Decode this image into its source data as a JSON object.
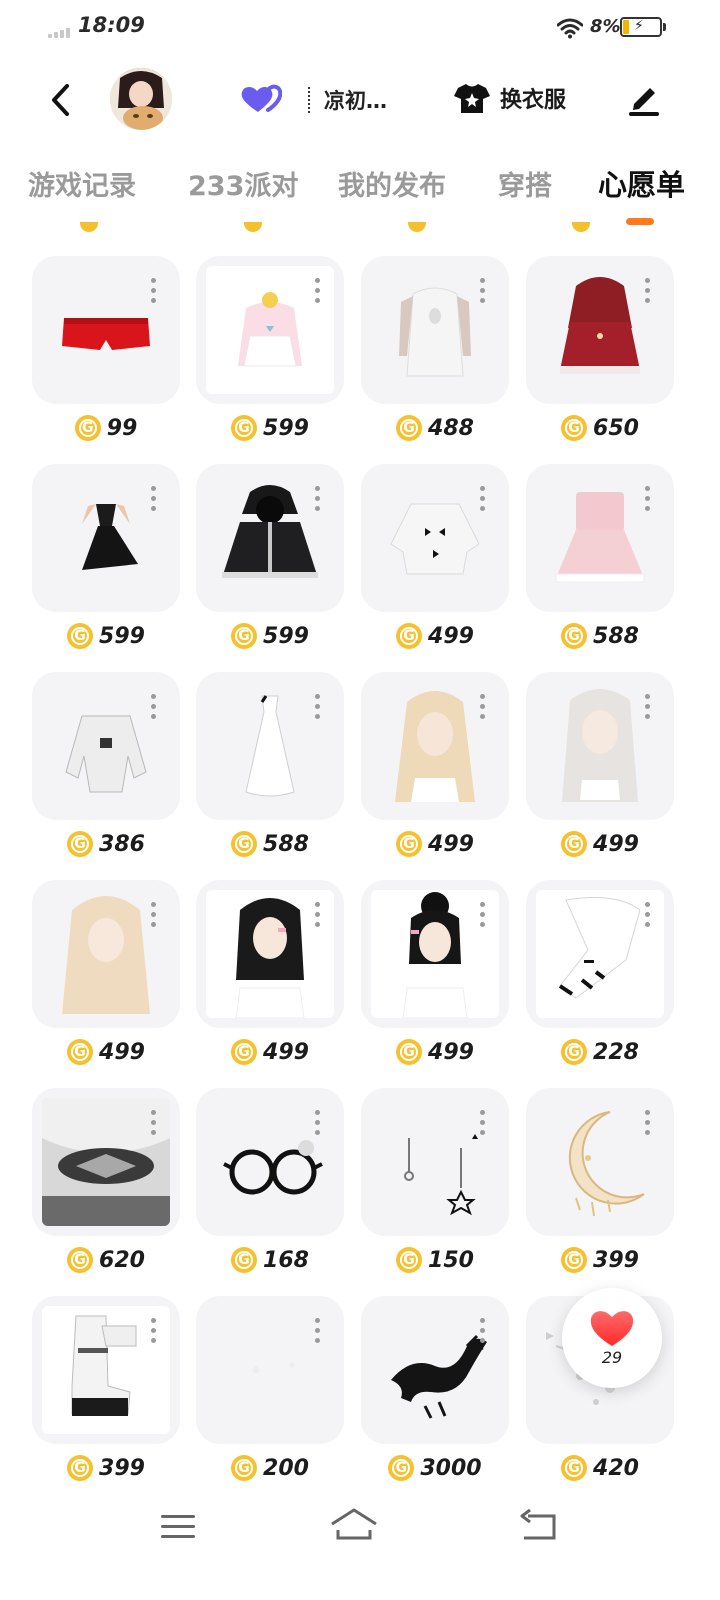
{
  "status_bar": {
    "time": "18:09",
    "battery_percent": "8%",
    "signal_icon": "signal-icon",
    "wifi_icon": "wifi-icon",
    "battery_icon": "battery-icon"
  },
  "header": {
    "nickname": "凉初…",
    "outfit_label": "换衣服"
  },
  "tabs": [
    {
      "label": "游戏记录"
    },
    {
      "label": "233派对"
    },
    {
      "label": "我的发布"
    },
    {
      "label": "穿搭"
    },
    {
      "label": "心愿单"
    }
  ],
  "active_tab": "心愿单",
  "colors": {
    "accent": "#ff7a1a",
    "coin": "#f6c12e",
    "card_bg": "#f4f4f7",
    "heart_purple": "#6b5cf0",
    "like_red": "#ff3b3b"
  },
  "items": [
    {
      "price": "99"
    },
    {
      "price": "599"
    },
    {
      "price": "488"
    },
    {
      "price": "650"
    },
    {
      "price": "599"
    },
    {
      "price": "599"
    },
    {
      "price": "499"
    },
    {
      "price": "588"
    },
    {
      "price": "386"
    },
    {
      "price": "588"
    },
    {
      "price": "499"
    },
    {
      "price": "499"
    },
    {
      "price": "499"
    },
    {
      "price": "499"
    },
    {
      "price": "499"
    },
    {
      "price": "228"
    },
    {
      "price": "620"
    },
    {
      "price": "168"
    },
    {
      "price": "150"
    },
    {
      "price": "399"
    },
    {
      "price": "399"
    },
    {
      "price": "200"
    },
    {
      "price": "3000"
    },
    {
      "price": "420"
    }
  ],
  "like": {
    "count": "29"
  }
}
